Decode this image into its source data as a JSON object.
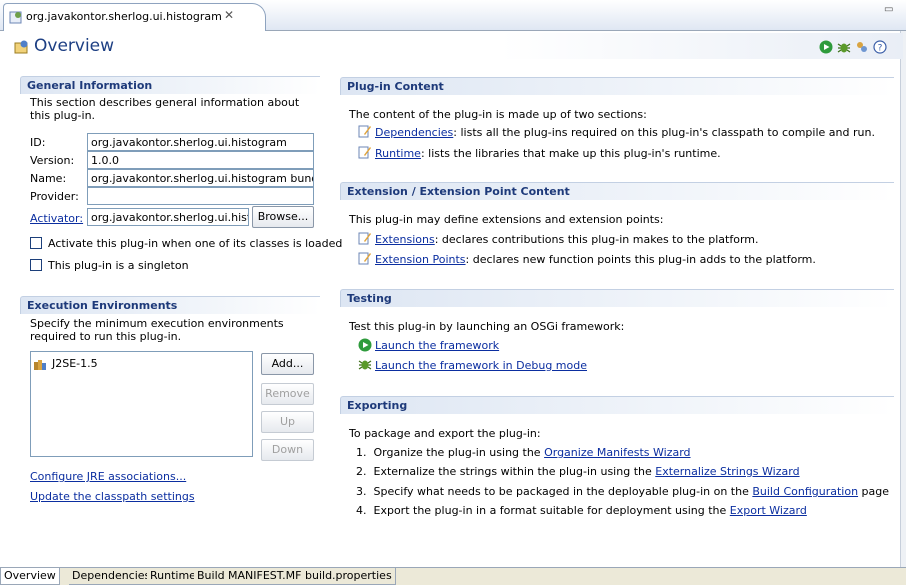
{
  "editor": {
    "tab_title": "org.javakontor.sherlog.ui.histogram",
    "close_glyph": "✕",
    "page_title": "Overview"
  },
  "header_icons": [
    "run-icon",
    "debug-icon",
    "export-icon",
    "help-icon"
  ],
  "general": {
    "title": "General Information",
    "description": "This section describes general information about this plug-in.",
    "fields": [
      {
        "label": "ID:",
        "value": "org.javakontor.sherlog.ui.histogram"
      },
      {
        "label": "Version:",
        "value": "1.0.0"
      },
      {
        "label": "Name:",
        "value": "org.javakontor.sherlog.ui.histogram bundle"
      },
      {
        "label": "Provider:",
        "value": ""
      }
    ],
    "activator_label": "Activator:",
    "activator_value": "org.javakontor.sherlog.ui.histo",
    "browse_label": "Browse...",
    "checkbox_activate": "Activate this plug-in when one of its classes is loaded",
    "checkbox_singleton": "This plug-in is a singleton"
  },
  "execution": {
    "title": "Execution Environments",
    "description": "Specify the minimum execution environments required to run this plug-in.",
    "items": [
      "J2SE-1.5"
    ],
    "buttons": {
      "add": "Add...",
      "remove": "Remove",
      "up": "Up",
      "down": "Down"
    },
    "link_jre": "Configure JRE associations...",
    "link_classpath": "Update the classpath settings"
  },
  "content": {
    "title": "Plug-in Content",
    "intro": "The content of the plug-in is made up of two sections:",
    "dependencies_link": "Dependencies",
    "dependencies_text": ": lists all the plug-ins required on this plug-in's classpath to compile and run.",
    "runtime_link": "Runtime",
    "runtime_text": ": lists the libraries that make up this plug-in's runtime."
  },
  "extension": {
    "title": "Extension / Extension Point Content",
    "intro": "This plug-in may define extensions and extension points:",
    "extensions_link": "Extensions",
    "extensions_text": ": declares contributions this plug-in makes to the platform.",
    "points_link": "Extension Points",
    "points_text": ": declares new function points this plug-in adds to the platform."
  },
  "testing": {
    "title": "Testing",
    "intro": "Test this plug-in by launching an OSGi framework:",
    "launch": "Launch the framework",
    "launch_debug": "Launch the framework in Debug mode"
  },
  "exporting": {
    "title": "Exporting",
    "intro": "To package and export the plug-in:",
    "steps": [
      {
        "num": "1.",
        "pre": "Organize the plug-in using the ",
        "link": "Organize Manifests Wizard",
        "post": ""
      },
      {
        "num": "2.",
        "pre": "Externalize the strings within the plug-in using the ",
        "link": "Externalize Strings Wizard",
        "post": ""
      },
      {
        "num": "3.",
        "pre": "Specify what needs to be packaged in the deployable plug-in on the ",
        "link": "Build Configuration",
        "post": " page"
      },
      {
        "num": "4.",
        "pre": "Export the plug-in in a format suitable for deployment using the ",
        "link": "Export Wizard",
        "post": ""
      }
    ]
  },
  "bottom_tabs": [
    "Overview",
    "Dependencies",
    "Runtime",
    "Build",
    "MANIFEST.MF",
    "build.properties"
  ],
  "colors": {
    "section_title": "#1e3a7a",
    "link": "#0b2ea0",
    "page_title": "#1d3f83"
  }
}
